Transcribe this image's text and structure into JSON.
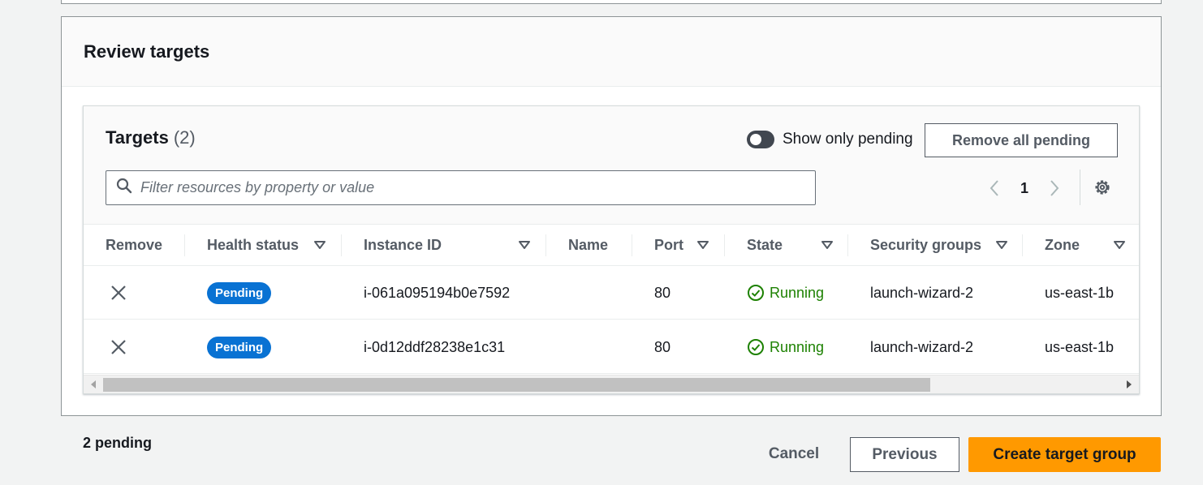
{
  "section": {
    "title": "Review targets"
  },
  "targets": {
    "title": "Targets",
    "count": "(2)",
    "toggle_label": "Show only pending",
    "remove_all_label": "Remove all pending",
    "search_placeholder": "Filter resources by property or value",
    "page": "1"
  },
  "table": {
    "columns": [
      "Remove",
      "Health status",
      "Instance ID",
      "Name",
      "Port",
      "State",
      "Security groups",
      "Zone"
    ],
    "rows": [
      {
        "health": "Pending",
        "instance_id": "i-061a095194b0e7592",
        "name": "",
        "port": "80",
        "state": "Running",
        "security_group": "launch-wizard-2",
        "zone": "us-east-1b"
      },
      {
        "health": "Pending",
        "instance_id": "i-0d12ddf28238e1c31",
        "name": "",
        "port": "80",
        "state": "Running",
        "security_group": "launch-wizard-2",
        "zone": "us-east-1b"
      }
    ]
  },
  "footer": {
    "pending_text": "2 pending",
    "cancel_label": "Cancel",
    "previous_label": "Previous",
    "create_label": "Create target group"
  },
  "colors": {
    "primary": "#ff9900",
    "badge_pending": "#0972d3",
    "running": "#1d8102"
  },
  "icons": [
    "search-icon",
    "chevron-left-icon",
    "chevron-right-icon",
    "gear-icon",
    "sort-triangle-icon",
    "close-icon",
    "check-circle-icon",
    "scroll-left-icon",
    "scroll-right-icon"
  ]
}
